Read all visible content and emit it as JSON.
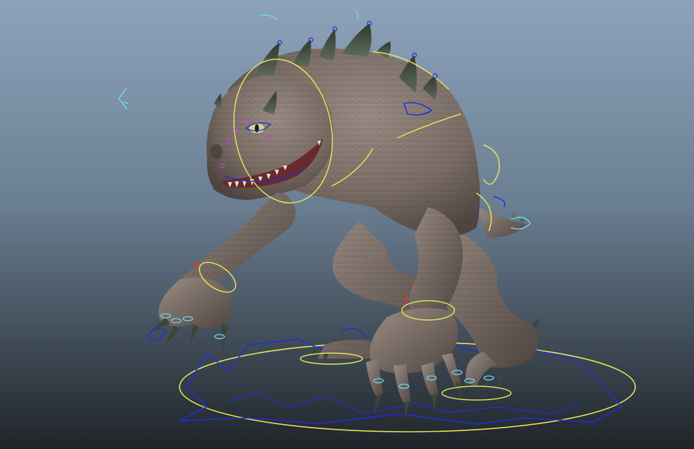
{
  "viewport": {
    "background": {
      "top_color": "#8da3ba",
      "mid_color": "#6b7f93",
      "bottom_color": "#1f2429"
    },
    "subject": "creature-rig",
    "colors": {
      "skin_light": "#9a8d84",
      "skin_mid": "#7a6d66",
      "skin_dark": "#4f4540",
      "spike": "#5e6a5a",
      "spike_tip": "#2f3a2e",
      "claw": "#3c4538",
      "teeth": "#e8e2d6",
      "mouth": "#6a2a2a",
      "control_yellow": "#e6e65a",
      "control_blue": "#1f2fd6",
      "control_cyan": "#6fd6f2",
      "control_red": "#e23a2a",
      "control_magenta": "#c048d8"
    }
  }
}
